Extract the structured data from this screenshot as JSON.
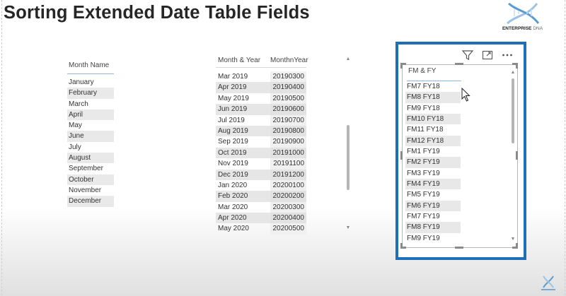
{
  "page": {
    "title": "Sorting Extended Date Table Fields"
  },
  "logo": {
    "brand": "ENTERPRISE",
    "brand_suffix": "DNA"
  },
  "month_table": {
    "header": "Month Name",
    "rows": [
      "January",
      "February",
      "March",
      "April",
      "May",
      "June",
      "July",
      "August",
      "September",
      "October",
      "November",
      "December"
    ]
  },
  "month_year_table": {
    "headers": [
      "Month & Year",
      "MonthnYear"
    ],
    "rows": [
      [
        "Mar 2019",
        "20190300"
      ],
      [
        "Apr 2019",
        "20190400"
      ],
      [
        "May 2019",
        "20190500"
      ],
      [
        "Jun 2019",
        "20190600"
      ],
      [
        "Jul 2019",
        "20190700"
      ],
      [
        "Aug 2019",
        "20190800"
      ],
      [
        "Sep 2019",
        "20190900"
      ],
      [
        "Oct 2019",
        "20191000"
      ],
      [
        "Nov 2019",
        "20191100"
      ],
      [
        "Dec 2019",
        "20191200"
      ],
      [
        "Jan 2020",
        "20200100"
      ],
      [
        "Feb 2020",
        "20200200"
      ],
      [
        "Mar 2020",
        "20200300"
      ],
      [
        "Apr 2020",
        "20200400"
      ],
      [
        "May 2020",
        "20200500"
      ]
    ]
  },
  "slicer": {
    "header": "FM & FY",
    "accent_color": "#1f6fb8",
    "header_icons": [
      "filter-icon",
      "focus-mode-icon",
      "more-options-icon"
    ],
    "items": [
      "FM7 FY18",
      "FM8 FY18",
      "FM9 FY18",
      "FM10 FY18",
      "FM11 FY18",
      "FM12 FY18",
      "FM1 FY19",
      "FM2 FY19",
      "FM3 FY19",
      "FM4 FY19",
      "FM5 FY19",
      "FM6 FY19",
      "FM7 FY19",
      "FM8 FY19",
      "FM9 FY19"
    ]
  }
}
